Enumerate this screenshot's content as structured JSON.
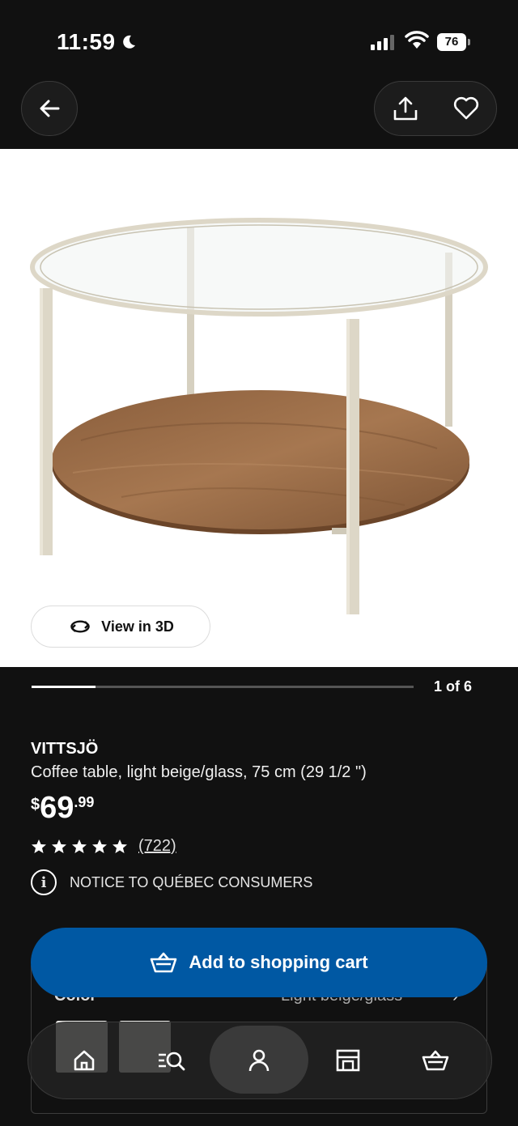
{
  "status_bar": {
    "time": "11:59",
    "battery": "76"
  },
  "product": {
    "name": "VITTSJÖ",
    "description": "Coffee table, light beige/glass, 75 cm (29 1/2 \")",
    "price": {
      "currency": "$",
      "integer": "69",
      "decimal": ".99"
    },
    "rating": {
      "stars": 5,
      "count": "(722)"
    },
    "notice": "NOTICE TO QUÉBEC CONSUMERS"
  },
  "gallery": {
    "view3d_label": "View in 3D",
    "counter": "1 of 6",
    "progress": 0.167
  },
  "add_to_cart_label": "Add to shopping cart",
  "options": {
    "color_label": "Color",
    "color_value": "Light beige/glass"
  },
  "bottom_nav": {
    "items": [
      {
        "icon": "home-icon"
      },
      {
        "icon": "search-list-icon"
      },
      {
        "icon": "profile-icon",
        "active": true
      },
      {
        "icon": "store-icon"
      },
      {
        "icon": "cart-icon"
      }
    ]
  },
  "colors": {
    "background": "#111111",
    "accent": "#0058a3",
    "star": "#ffffff"
  }
}
